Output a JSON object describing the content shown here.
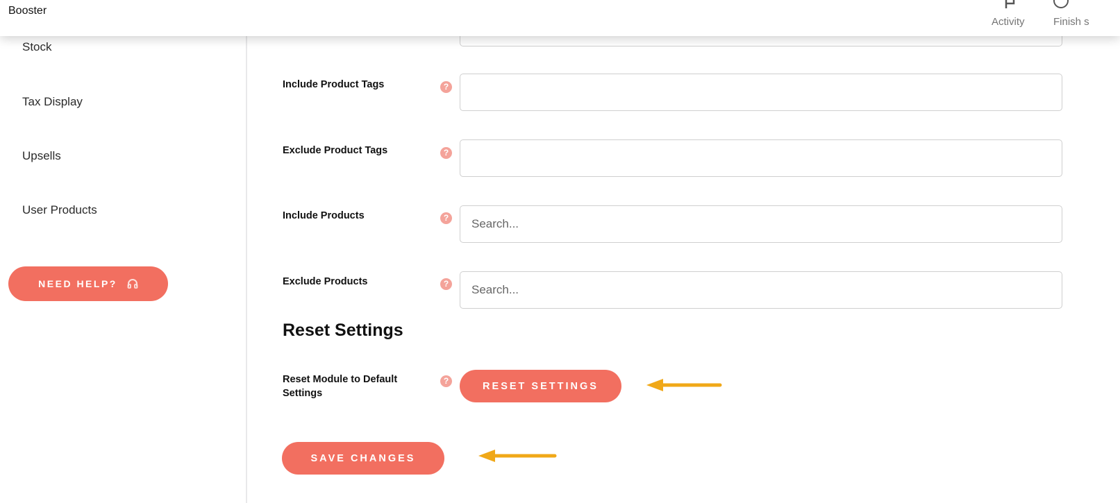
{
  "header": {
    "title": "Booster",
    "activity_label": "Activity",
    "finish_setup_label": "Finish s"
  },
  "sidebar": {
    "items": [
      {
        "label": "Stock"
      },
      {
        "label": "Tax Display"
      },
      {
        "label": "Upsells"
      },
      {
        "label": "User Products"
      }
    ],
    "help_button": "NEED HELP?"
  },
  "form": {
    "rows": [
      {
        "label": "Include Product Tags",
        "value": "",
        "placeholder": ""
      },
      {
        "label": "Exclude Product Tags",
        "value": "",
        "placeholder": ""
      },
      {
        "label": "Include Products",
        "value": "",
        "placeholder": "Search..."
      },
      {
        "label": "Exclude Products",
        "value": "",
        "placeholder": "Search..."
      }
    ],
    "help_glyph": "?"
  },
  "reset": {
    "section_title": "Reset Settings",
    "label": "Reset Module to Default Settings",
    "button": "RESET SETTINGS"
  },
  "save_button": "SAVE CHANGES",
  "colors": {
    "accent": "#f26f60",
    "help_icon": "#f4a39a",
    "annotation_arrow": "#f0a818"
  }
}
